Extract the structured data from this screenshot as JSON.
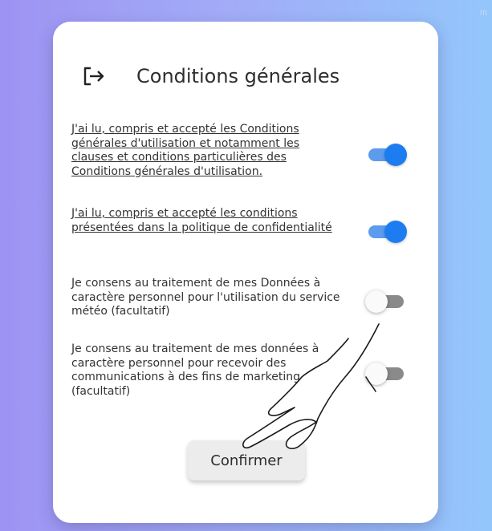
{
  "page": {
    "corner_mark": "m"
  },
  "header": {
    "icon": "logout-icon",
    "title": "Conditions générales"
  },
  "consents": [
    {
      "label": "J'ai lu, compris et accepté les Conditions générales d'utilisation et notamment les clauses et conditions particulières des Conditions générales d'utilisation.",
      "linked": true,
      "checked": true
    },
    {
      "label": "J'ai lu, compris et accepté les conditions présentées dans la politique de confidentialité",
      "linked": true,
      "checked": true
    },
    {
      "label": "Je consens au traitement de mes Données à caractère personnel pour l'utilisation du service météo (facultatif)",
      "linked": false,
      "checked": false
    },
    {
      "label": "Je consens au traitement de mes données à caractère personnel pour recevoir des communications à des fins de marketing (facultatif)",
      "linked": false,
      "checked": false
    }
  ],
  "actions": {
    "confirm_label": "Confirmer"
  },
  "overlay": {
    "icon": "pointing-hand-icon"
  },
  "colors": {
    "toggle_on_knob": "#1d7df0",
    "toggle_on_track": "#5c9bed",
    "toggle_off_track": "#8a8a8a",
    "background_left": "#9d93f2",
    "background_right": "#93c6fb"
  }
}
